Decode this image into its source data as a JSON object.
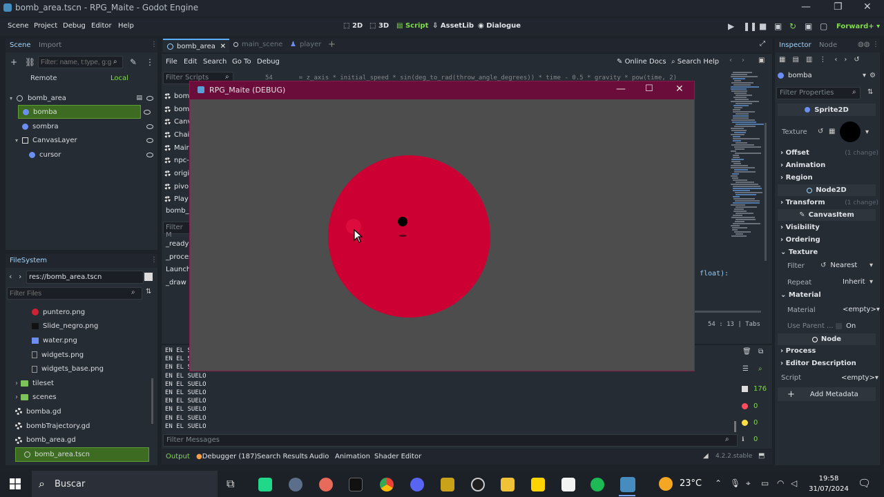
{
  "window_title": "bomb_area.tscn - RPG_Maite - Godot Engine",
  "menu": [
    "Scene",
    "Project",
    "Debug",
    "Editor",
    "Help"
  ],
  "workspaces": [
    "2D",
    "3D",
    "Script",
    "AssetLib",
    "Dialogue"
  ],
  "renderer": "Forward+",
  "scene_dock": {
    "tabs": [
      "Scene",
      "Import"
    ],
    "filter_placeholder": "Filter: name, t:type, g:g",
    "remote_label": "Remote",
    "local_label": "Local",
    "nodes": [
      {
        "name": "bomb_area",
        "level": 0
      },
      {
        "name": "bomba",
        "level": 1,
        "selected": true
      },
      {
        "name": "sombra",
        "level": 1
      },
      {
        "name": "CanvasLayer",
        "level": 1
      },
      {
        "name": "cursor",
        "level": 2
      }
    ]
  },
  "filesystem": {
    "title": "FileSystem",
    "path": "res://bomb_area.tscn",
    "filter_placeholder": "Filter Files",
    "items": [
      {
        "name": "puntero.png",
        "icon": "red"
      },
      {
        "name": "Slide_negro.png",
        "icon": "dark"
      },
      {
        "name": "water.png",
        "icon": "img"
      },
      {
        "name": "widgets.png",
        "icon": "file"
      },
      {
        "name": "widgets_base.png",
        "icon": "file"
      },
      {
        "name": "tileset",
        "icon": "folder"
      },
      {
        "name": "scenes",
        "icon": "folder"
      },
      {
        "name": "bomba.gd",
        "icon": "gear"
      },
      {
        "name": "bombTrajectory.gd",
        "icon": "gear"
      },
      {
        "name": "bomb_area.gd",
        "icon": "gear"
      },
      {
        "name": "bomb_area.tscn",
        "icon": "scene"
      }
    ]
  },
  "editor_tabs": [
    "bomb_area",
    "main_scene",
    "player"
  ],
  "script_menu": [
    "File",
    "Edit",
    "Search",
    "Go To",
    "Debug"
  ],
  "online_docs": "Online Docs",
  "search_help": "Search Help",
  "filter_scripts": "Filter Scripts",
  "script_list": [
    "bom",
    "bom",
    "Canv",
    "Chai",
    "Mair",
    "npc-",
    "origi",
    "pivo",
    "Play"
  ],
  "current_script_short": "bomb_",
  "filter_methods": "Filter M",
  "methods": [
    "_ready",
    "_proces",
    "LaunchF",
    "_draw"
  ],
  "code_line_partial": "float):",
  "cursor_pos": "54 :",
  "cursor_col": "13",
  "indent_mode": "Tabs",
  "output_lines": [
    "EN EL S",
    "EN EL S",
    "EN EL S",
    "EN EL SUELO",
    "EN EL SUELO",
    "EN EL SUELO",
    "EN EL SUELO",
    "EN EL SUELO",
    "EN EL SUELO",
    "EN EL SUELO"
  ],
  "filter_messages": "Filter Messages",
  "counts": {
    "messages": "176",
    "errors": "0",
    "warnings": "0",
    "info": "0"
  },
  "bottom_tabs": [
    "Output",
    "Debugger (187)",
    "Search Results",
    "Audio",
    "Animation",
    "Shader Editor"
  ],
  "version": "4.2.2.stable",
  "debug_window": {
    "title": "RPG_Maite (DEBUG)",
    "bg_color": "#4d4d4d",
    "circle_color": "#cc0033"
  },
  "inspector": {
    "tabs": [
      "Inspector",
      "Node"
    ],
    "object": "bomba",
    "filter_placeholder": "Filter Properties",
    "class": "Sprite2D",
    "texture_label": "Texture",
    "sections": [
      {
        "label": "Offset",
        "note": "(1 change)"
      },
      {
        "label": "Animation",
        "note": ""
      },
      {
        "label": "Region",
        "note": ""
      }
    ],
    "node2d": "Node2D",
    "transform": {
      "label": "Transform",
      "note": "(1 change)"
    },
    "canvasitem": "CanvasItem",
    "ci_sections": [
      "Visibility",
      "Ordering",
      "Texture"
    ],
    "filter_label": "Filter",
    "filter_value": "Nearest",
    "repeat_label": "Repeat",
    "repeat_value": "Inherit",
    "material_section": "Material",
    "material_label": "Material",
    "material_value": "<empty>",
    "use_parent_label": "Use Parent ...",
    "use_parent_value": "On",
    "node_band": "Node",
    "node_sections": [
      "Process",
      "Editor Description"
    ],
    "script_label": "Script",
    "script_value": "<empty>",
    "add_metadata": "Add Metadata"
  },
  "taskbar": {
    "search": "Buscar",
    "temperature": "23°C",
    "time": "19:58",
    "date": "31/07/2024"
  }
}
